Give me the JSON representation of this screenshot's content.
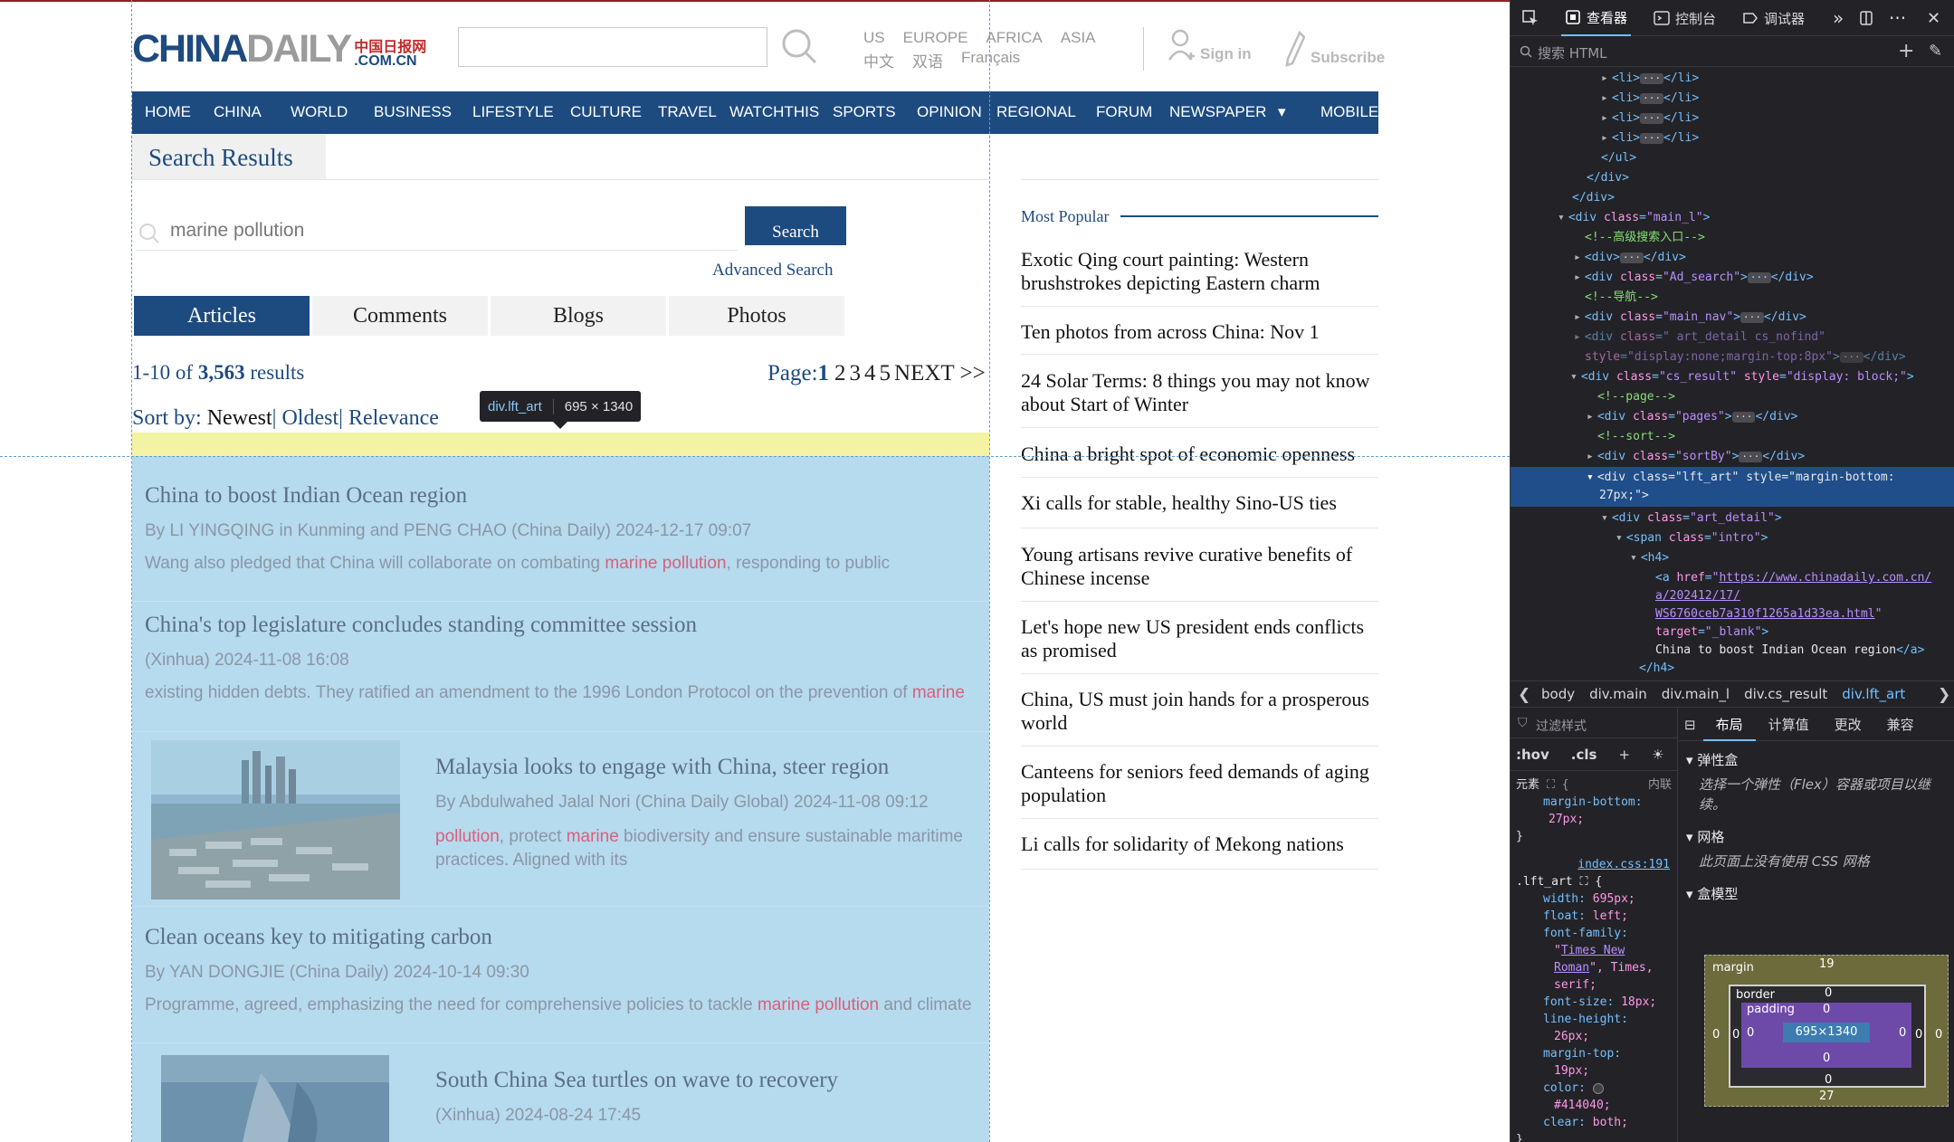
{
  "site": {
    "logo_china": "CHINA",
    "logo_daily": "DAILY",
    "logo_zh": "中国日报网",
    "logo_domain": ".COM.CN",
    "regions_row1": [
      "US",
      "EUROPE",
      "AFRICA",
      "ASIA"
    ],
    "regions_row2": [
      "中文",
      "双语",
      "Français"
    ],
    "signin": "Sign in",
    "subscribe": "Subscribe"
  },
  "nav": [
    "HOME",
    "CHINA",
    "WORLD",
    "BUSINESS",
    "LIFESTYLE",
    "CULTURE",
    "TRAVEL",
    "WATCHTHIS",
    "SPORTS",
    "OPINION",
    "REGIONAL",
    "FORUM",
    "NEWSPAPER",
    "MOBILE"
  ],
  "search": {
    "heading": "Search Results",
    "query": "marine pollution",
    "button": "Search",
    "advanced": "Advanced Search",
    "tabs": [
      "Articles",
      "Comments",
      "Blogs",
      "Photos"
    ],
    "count_prefix": "1-10 of ",
    "count_total": "3,563",
    "count_suffix": " results",
    "page_label": "Page:",
    "current_page": "1",
    "pages": [
      "2",
      "3",
      "4",
      "5"
    ],
    "next": "NEXT >>",
    "sort_label": "Sort by: ",
    "sort_newest": "Newest",
    "sort_oldest": "| Oldest",
    "sort_relevance": "| Relevance"
  },
  "tooltip": {
    "tag": "div.lft_art",
    "dims": "695 × 1340"
  },
  "articles": [
    {
      "title": "China to boost Indian Ocean region",
      "meta": "By LI YINGQING in Kunming and PENG CHAO (China Daily) 2024-12-17 09:07",
      "intro_pre": "Wang also pledged that China will collaborate on combating ",
      "intro_hl": "marine pollution",
      "intro_post": ", responding to public"
    },
    {
      "title": "China's top legislature concludes standing committee session",
      "meta": "(Xinhua) 2024-11-08 16:08",
      "intro_pre": "existing hidden debts. They ratified an amendment to the 1996 London Protocol on the prevention of ",
      "intro_hl": "marine",
      "intro_post": ""
    },
    {
      "title": "Malaysia looks to engage with China, steer region",
      "meta": "By Abdulwahed Jalal Nori (China Daily Global) 2024-11-08 09:12",
      "intro_hl1": "pollution",
      "intro_mid": ", protect ",
      "intro_hl2": "marine",
      "intro_post": " biodiversity and ensure sustainable maritime practices. Aligned with its"
    },
    {
      "title": "Clean oceans key to mitigating carbon",
      "meta": "By YAN DONGJIE (China Daily) 2024-10-14 09:30",
      "intro_pre": "Programme, agreed, emphasizing the need for comprehensive policies to tackle ",
      "intro_hl": "marine pollution",
      "intro_post": " and climate"
    },
    {
      "title": "South China Sea turtles on wave to recovery",
      "meta": "(Xinhua) 2024-08-24 17:45"
    }
  ],
  "popular": {
    "title": "Most Popular",
    "items": [
      "Exotic Qing court painting: Western brushstrokes depicting Eastern charm",
      "Ten photos from across China: Nov 1",
      "24 Solar Terms: 8 things you may not know about Start of Winter",
      "China a bright spot of economic openness",
      "Xi calls for stable, healthy Sino-US ties",
      "Young artisans revive curative benefits of Chinese incense",
      "Let's hope new US president ends conflicts as promised",
      "China, US must join hands for a prosperous world",
      "Canteens for seniors feed demands of aging population",
      "Li calls for solidarity of Mekong nations"
    ]
  },
  "devtools": {
    "tabs": [
      "查看器",
      "控制台",
      "调试器"
    ],
    "search_placeholder": "搜索 HTML",
    "crumbs": [
      "body",
      "div.main",
      "div.main_l",
      "div.cs_result",
      "div.lft_art"
    ],
    "styles_filter": "过滤样式",
    "pseudo": ":hov",
    "cls": ".cls",
    "element_label": "元素",
    "inline_label": "内联",
    "layout_tabs": [
      "布局",
      "计算值",
      "更改",
      "兼容"
    ],
    "flex_title": "弹性盒",
    "flex_note": "选择一个弹性（Flex）容器或项目以继续。",
    "grid_title": "网格",
    "grid_note": "此页面上没有使用 CSS 网格",
    "boxmodel_title": "盒模型",
    "css_source": "index.css:191",
    "box": {
      "margin_top": "19",
      "margin_bottom": "27",
      "margin_left": "0",
      "margin_right": "0",
      "border": "0",
      "padding": "0",
      "content": "695×1340",
      "margin_label": "margin",
      "border_label": "border",
      "padding_label": "padding"
    }
  }
}
